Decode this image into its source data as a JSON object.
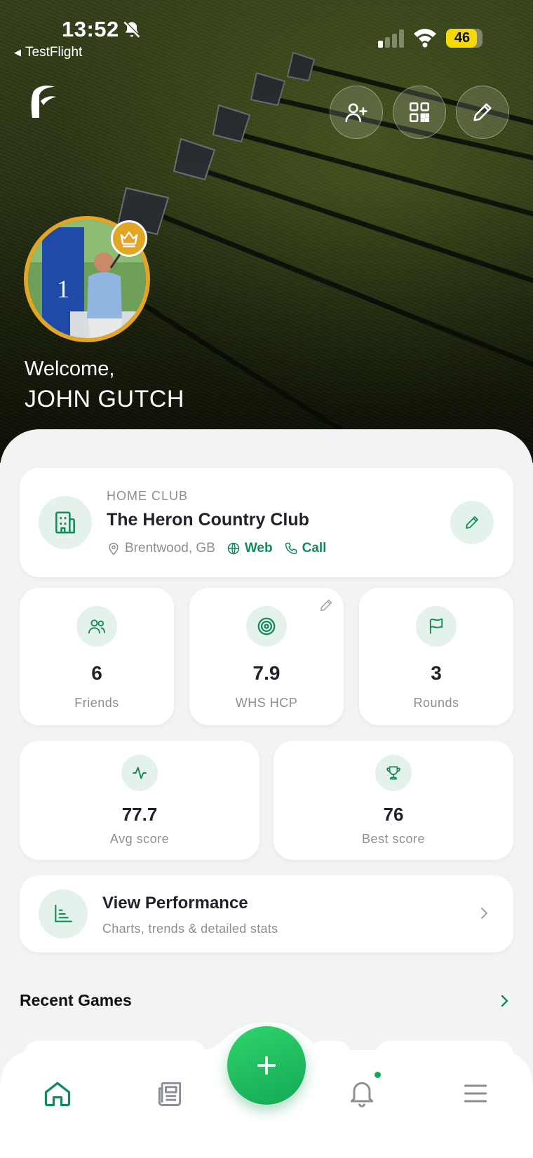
{
  "status_bar": {
    "time": "13:52",
    "back_app": "TestFlight",
    "battery_level": "46",
    "battery_fraction": 0.46
  },
  "header": {
    "logo": "brand-f-logo",
    "actions": [
      {
        "name": "add-friend",
        "icon": "user-plus-icon"
      },
      {
        "name": "qr-code",
        "icon": "qr-code-icon"
      },
      {
        "name": "edit-profile",
        "icon": "pencil-icon"
      }
    ]
  },
  "profile": {
    "welcome": "Welcome,",
    "name": "JOHN GUTCH",
    "badge_icon": "crown-icon"
  },
  "home_club": {
    "label": "HOME CLUB",
    "name": "The Heron Country Club",
    "location": "Brentwood, GB",
    "web_label": "Web",
    "call_label": "Call"
  },
  "stats": [
    {
      "value": "6",
      "label": "Friends",
      "icon": "users-icon"
    },
    {
      "value": "7.9",
      "label": "WHS HCP",
      "icon": "target-icon"
    },
    {
      "value": "3",
      "label": "Rounds",
      "icon": "flag-icon"
    },
    {
      "value": "77.7",
      "label": "Avg score",
      "icon": "activity-icon"
    },
    {
      "value": "76",
      "label": "Best score",
      "icon": "trophy-icon"
    }
  ],
  "performance": {
    "title": "View Performance",
    "subtitle": "Charts, trends & detailed stats"
  },
  "recent_games": {
    "title": "Recent Games"
  },
  "bottom_nav": [
    {
      "name": "home",
      "icon": "home-icon",
      "active": true
    },
    {
      "name": "news",
      "icon": "newspaper-icon",
      "active": false
    },
    {
      "name": "add",
      "icon": "plus-icon",
      "active": false
    },
    {
      "name": "notifications",
      "icon": "bell-icon",
      "active": false
    },
    {
      "name": "menu",
      "icon": "menu-icon",
      "active": false
    }
  ],
  "colors": {
    "accent": "#148a5a",
    "fab": "#1fbf60",
    "gold": "#e2a526",
    "background": "#f2f3f3"
  }
}
